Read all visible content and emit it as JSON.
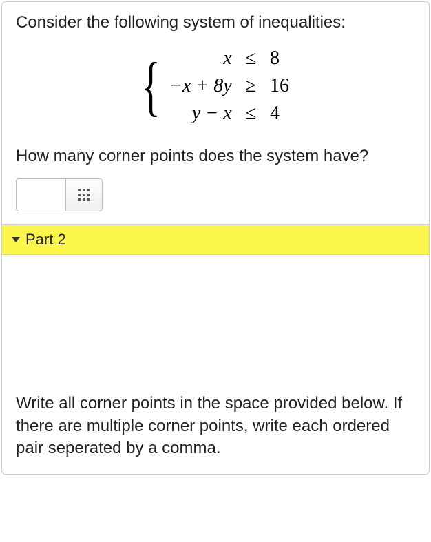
{
  "part1": {
    "intro": "Consider the following system of inequalities:",
    "rows": [
      {
        "lhs": "x",
        "rel": "≤",
        "rhs": "8"
      },
      {
        "lhs": "−x + 8y",
        "rel": "≥",
        "rhs": "16"
      },
      {
        "lhs": "y − x",
        "rel": "≤",
        "rhs": "4"
      }
    ],
    "question": "How many corner points does the system have?"
  },
  "part2": {
    "label": "Part 2",
    "instructions": "Write all corner points in the space provided below. If there are multiple corner points, write each ordered pair seperated by a comma."
  }
}
